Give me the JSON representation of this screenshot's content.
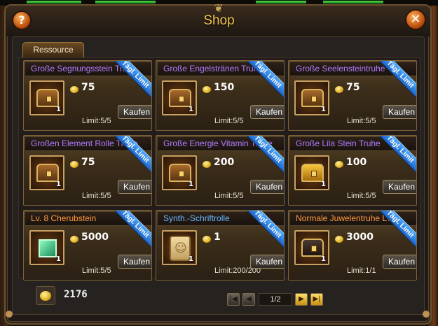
{
  "window": {
    "title": "Shop",
    "help_label": "?",
    "close_label": "✕"
  },
  "tab": {
    "label": "Ressource"
  },
  "ribbon_label": "Tägl. Limit",
  "buy_label": "Kaufen",
  "items": [
    {
      "name": "Große Segnungsstein Truhe",
      "name_color": "purple",
      "price": "75",
      "limit": "Limit:5/5",
      "qty": "1",
      "icon": "chest-icon"
    },
    {
      "name": "Große Engelstränen Truhe",
      "name_color": "purple",
      "price": "150",
      "limit": "Limit:5/5",
      "qty": "1",
      "icon": "chest-icon"
    },
    {
      "name": "Große Seelensteintruhe",
      "name_color": "purple",
      "price": "75",
      "limit": "Limit:5/5",
      "qty": "1",
      "icon": "chest-icon"
    },
    {
      "name": "Großen Element Rolle Truhe",
      "name_color": "purple",
      "price": "75",
      "limit": "Limit:5/5",
      "qty": "1",
      "icon": "chest-icon"
    },
    {
      "name": "Große Energie Vitamin Truhe",
      "name_color": "purple",
      "price": "200",
      "limit": "Limit:5/5",
      "qty": "1",
      "icon": "chest-icon"
    },
    {
      "name": "Große Lila Stein Truhe",
      "name_color": "purple",
      "price": "100",
      "limit": "Limit:5/5",
      "qty": "1",
      "icon": "gold-chest-icon"
    },
    {
      "name": "Lv. 8 Cherubstein",
      "name_color": "orange",
      "price": "5000",
      "limit": "Limit:5/5",
      "qty": "1",
      "icon": "gem-icon"
    },
    {
      "name": "Synth.-Schriftrolle",
      "name_color": "blue",
      "price": "1",
      "limit": "Limit:200/200",
      "qty": "1",
      "icon": "scroll-icon"
    },
    {
      "name": "Normale Juwelentruhe Lv.",
      "name_color": "orange",
      "price": "3000",
      "limit": "Limit:1/1",
      "qty": "1",
      "icon": "dark-chest-icon"
    }
  ],
  "balance": {
    "amount": "2176",
    "icon": "coin-icon"
  },
  "pagination": {
    "current": "1/2",
    "first": "first-page-icon",
    "prev": "prev-page-icon",
    "next": "next-page-icon",
    "last": "last-page-icon"
  },
  "colors": {
    "title": "#f1c24a",
    "purple": "#b27cff",
    "orange": "#ff9a3c",
    "blue": "#6ab8ff",
    "ribbon": "#2a80e0"
  }
}
